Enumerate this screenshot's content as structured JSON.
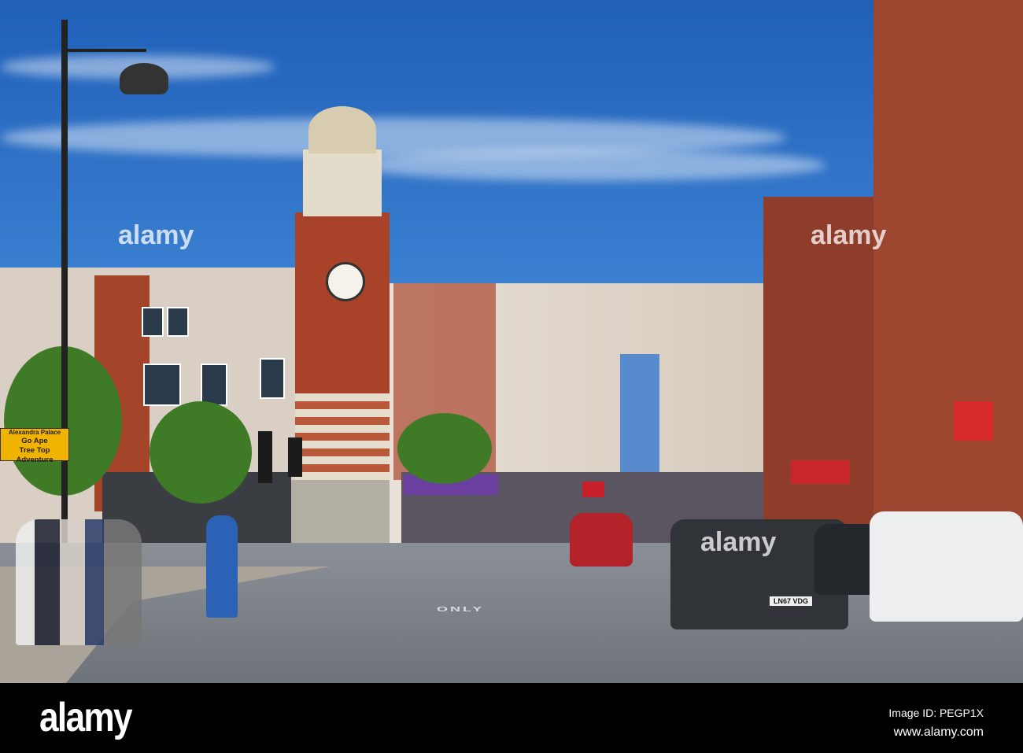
{
  "photo": {
    "street_sign": {
      "line1": "Alexandra Palace",
      "line2": "Go Ape",
      "line3": "Tree Top",
      "line4": "Adventure"
    },
    "number_plate": "LN67 VDG",
    "road_marking": "ONLY",
    "watermark": "alamy"
  },
  "footer": {
    "logo": "alamy",
    "image_id": "Image ID: PEGP1X",
    "website": "www.alamy.com"
  }
}
